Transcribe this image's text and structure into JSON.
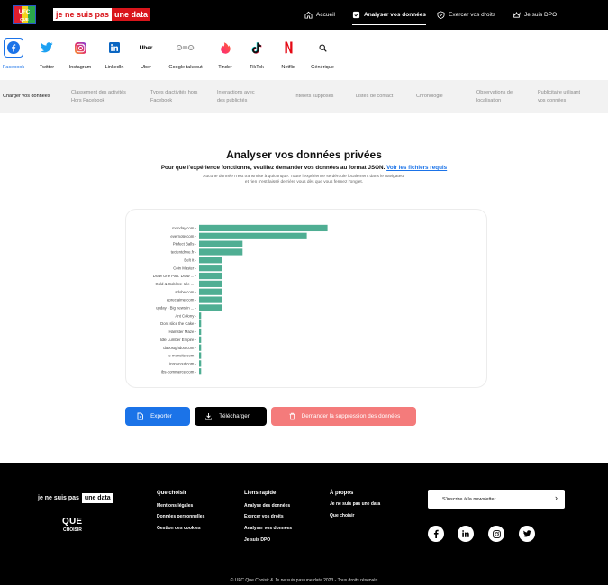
{
  "header": {
    "logo_text_a": "je ne suis pas",
    "logo_text_b": "une data",
    "ufc_logo_text": "UFC QUE CHOISIR",
    "nav": [
      {
        "label": "Accueil",
        "icon": "home-icon"
      },
      {
        "label": "Analyser vos données",
        "icon": "chart-check-icon",
        "active": true
      },
      {
        "label": "Exercer vos droits",
        "icon": "shield-icon"
      },
      {
        "label": "Je suis DPO",
        "icon": "crown-icon"
      }
    ]
  },
  "platforms": [
    {
      "label": "Facebook",
      "icon": "facebook-icon",
      "active": true
    },
    {
      "label": "Twitter",
      "icon": "twitter-icon"
    },
    {
      "label": "Instagram",
      "icon": "instagram-icon"
    },
    {
      "label": "LinkedIn",
      "icon": "linkedin-icon"
    },
    {
      "label": "Uber",
      "icon": "uber-logo",
      "logo_text": "Uber"
    },
    {
      "label": "Google takeout",
      "icon": "google-takeout-icon"
    },
    {
      "label": "Tinder",
      "icon": "tinder-icon"
    },
    {
      "label": "TikTok",
      "icon": "tiktok-icon"
    },
    {
      "label": "Netflix",
      "icon": "netflix-icon"
    },
    {
      "label": "Générique",
      "icon": "search-icon"
    }
  ],
  "categories": [
    {
      "line1": "Charger vos données",
      "line2": "",
      "active": true
    },
    {
      "line1": "Classement des activités",
      "line2": "Hors Facebook"
    },
    {
      "line1": "Types d'activités hors",
      "line2": "Facebook"
    },
    {
      "line1": "Interactions avec",
      "line2": "des publicités"
    },
    {
      "line1": "Intérêts supposés",
      "line2": ""
    },
    {
      "line1": "Listes de contact",
      "line2": ""
    },
    {
      "line1": "Chronologie",
      "line2": ""
    },
    {
      "line1": "Observations de",
      "line2": "localisation"
    },
    {
      "line1": "Publicitaire utilisant",
      "line2": "vos données"
    }
  ],
  "main": {
    "title": "Analyser vos données privées",
    "subtitle": "Pour que l'expérience fonctionne, veuillez demander vos données au format JSON.",
    "subtitle_link": "Voir les fichiers requis",
    "note": "Aucune donnée n'est transmise à quiconque. Toute l'expérience se déroule localement dans le navigateur et rien n'est laissé derrière vous dès que vous fermez l'onglet."
  },
  "chart_data": {
    "type": "bar",
    "orientation": "horizontal",
    "categories": [
      "monday.com",
      "evernote.com",
      "Pinfect Balls",
      "tecientdrive.fr",
      "Belt It",
      "Coin Master",
      "Draw One Part: Draw ...",
      "Gold & Goblins: Idle ...",
      "adobe.com",
      "epreclaime.com",
      "upday - Big news in ...",
      "Ant Colony",
      "Dont slice the Cake",
      "Hamster Maze",
      "Idle Lumber Empire",
      "dapostghdoo.com",
      "e-monsite.com",
      "iconscout.com",
      "ibs-commerce.com"
    ],
    "values": [
      62,
      52,
      21,
      21,
      11,
      11,
      11,
      11,
      11,
      11,
      11,
      1,
      1,
      1,
      1,
      1,
      1,
      1,
      1
    ],
    "xlim": [
      0,
      140
    ],
    "bar_color": "#4fae93",
    "grid": false,
    "title": "",
    "xlabel": "",
    "ylabel": ""
  },
  "buttons": {
    "export": {
      "label": "Exporter",
      "color": "#1b73e8",
      "icon": "export-icon"
    },
    "download": {
      "label": "Télécharger",
      "color": "#000000",
      "icon": "download-icon"
    },
    "delete": {
      "label": "Demander la suppression des données",
      "color": "#f47b7b",
      "icon": "trash-icon"
    }
  },
  "footer": {
    "logo_a": "je ne suis pas",
    "logo_b": "une data",
    "que": "QUE",
    "choisir": "CHOISIR",
    "columns": [
      {
        "title": "Que choisir",
        "items": [
          "Mentions légales",
          "Données personnelles",
          "Gestion des cookies"
        ]
      },
      {
        "title": "Liens rapide",
        "items": [
          "Analyse des données",
          "Exercer vos droits",
          "Analyser vos données",
          "Je suis DPO"
        ]
      },
      {
        "title": "À propos",
        "items": [
          "Je ne suis pas une data",
          "Que choisir"
        ]
      }
    ],
    "newsletter_label": "S'inscrire à la newsletter",
    "socials": [
      "facebook-icon",
      "linkedin-icon",
      "instagram-icon",
      "twitter-icon"
    ],
    "copyright": "© UFC Que Choisir & Je ne suis pas une data 2023 - Tous droits réservés"
  }
}
